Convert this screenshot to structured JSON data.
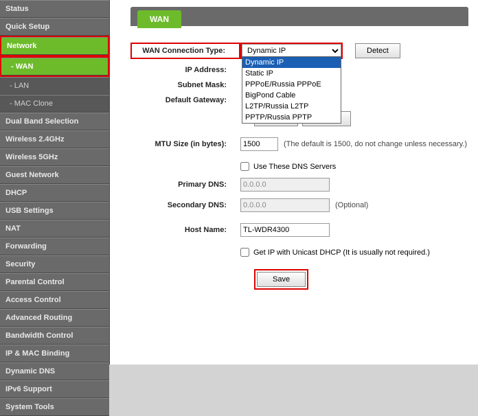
{
  "sidebar": {
    "items": [
      {
        "label": "Status",
        "active": false,
        "sub": false
      },
      {
        "label": "Quick Setup",
        "active": false,
        "sub": false
      },
      {
        "label": "Network",
        "active": true,
        "sub": false,
        "red": true
      },
      {
        "label": "- WAN",
        "active": true,
        "sub": true,
        "red": true
      },
      {
        "label": "- LAN",
        "active": false,
        "sub": true
      },
      {
        "label": "- MAC Clone",
        "active": false,
        "sub": true
      },
      {
        "label": "Dual Band Selection",
        "active": false,
        "sub": false
      },
      {
        "label": "Wireless 2.4GHz",
        "active": false,
        "sub": false
      },
      {
        "label": "Wireless 5GHz",
        "active": false,
        "sub": false
      },
      {
        "label": "Guest Network",
        "active": false,
        "sub": false
      },
      {
        "label": "DHCP",
        "active": false,
        "sub": false
      },
      {
        "label": "USB Settings",
        "active": false,
        "sub": false
      },
      {
        "label": "NAT",
        "active": false,
        "sub": false
      },
      {
        "label": "Forwarding",
        "active": false,
        "sub": false
      },
      {
        "label": "Security",
        "active": false,
        "sub": false
      },
      {
        "label": "Parental Control",
        "active": false,
        "sub": false
      },
      {
        "label": "Access Control",
        "active": false,
        "sub": false
      },
      {
        "label": "Advanced Routing",
        "active": false,
        "sub": false
      },
      {
        "label": "Bandwidth Control",
        "active": false,
        "sub": false
      },
      {
        "label": "IP & MAC Binding",
        "active": false,
        "sub": false
      },
      {
        "label": "Dynamic DNS",
        "active": false,
        "sub": false
      },
      {
        "label": "IPv6 Support",
        "active": false,
        "sub": false
      },
      {
        "label": "System Tools",
        "active": false,
        "sub": false
      }
    ]
  },
  "page": {
    "title": "WAN",
    "wan_type_label": "WAN Connection Type:",
    "wan_type_value": "Dynamic IP",
    "wan_type_options": [
      "Dynamic IP",
      "Static IP",
      "PPPoE/Russia PPPoE",
      "BigPond Cable",
      "L2TP/Russia L2TP",
      "PPTP/Russia PPTP"
    ],
    "detect_btn": "Detect",
    "ip_label": "IP Address:",
    "subnet_label": "Subnet Mask:",
    "gateway_label": "Default Gateway:",
    "renew_btn": "Renew",
    "release_btn": "Release",
    "mtu_label": "MTU Size (in bytes):",
    "mtu_value": "1500",
    "mtu_hint": "(The default is 1500, do not change unless necessary.)",
    "dns_check_label": "Use These DNS Servers",
    "pdns_label": "Primary DNS:",
    "pdns_value": "0.0.0.0",
    "sdns_label": "Secondary DNS:",
    "sdns_value": "0.0.0.0",
    "sdns_hint": "(Optional)",
    "host_label": "Host Name:",
    "host_value": "TL-WDR4300",
    "unicast_label": "Get IP with Unicast DHCP (It is usually not required.)",
    "save_btn": "Save"
  }
}
